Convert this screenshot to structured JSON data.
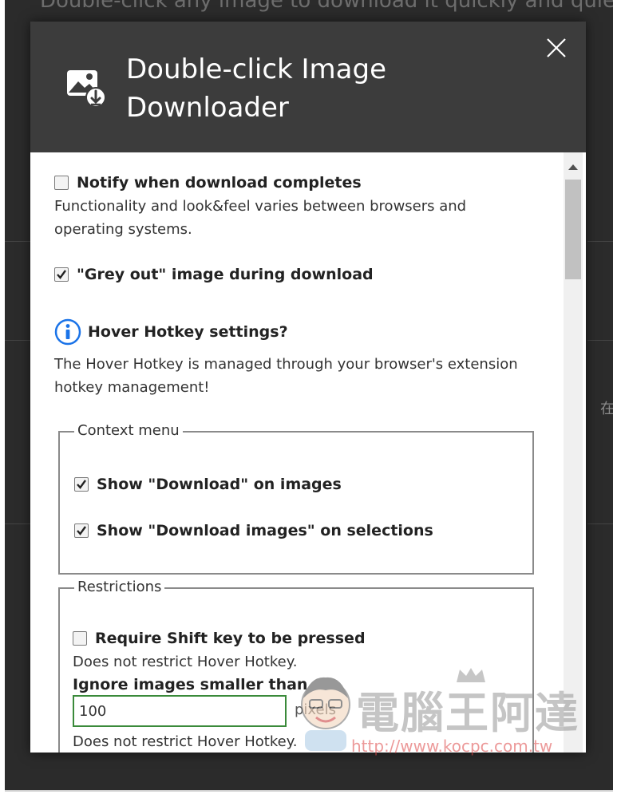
{
  "background": {
    "text": "Double-click any image to download it quickly and quietly, or",
    "side_char": "在"
  },
  "dialog": {
    "title": "Double-click Image Downloader",
    "close_label": "×"
  },
  "options": {
    "notify": {
      "label": "Notify when download completes",
      "checked": false,
      "description": "Functionality and look&feel varies between browsers and operating systems."
    },
    "grey_out": {
      "label": "\"Grey out\" image during download",
      "checked": true
    },
    "hotkey_info": {
      "title": "Hover Hotkey settings?",
      "description": "The Hover Hotkey is managed through your browser's extension hotkey management!"
    }
  },
  "context_menu": {
    "legend": "Context menu",
    "items": [
      {
        "label": "Show \"Download\" on images",
        "checked": true
      },
      {
        "label": "Show \"Download images\" on selections",
        "checked": true
      }
    ]
  },
  "restrictions": {
    "legend": "Restrictions",
    "shift": {
      "label": "Require Shift key to be pressed",
      "checked": false,
      "description": "Does not restrict Hover Hotkey."
    },
    "min_size": {
      "label": "Ignore images smaller than",
      "value": "100",
      "unit": "pixels",
      "description": "Does not restrict Hover Hotkey."
    }
  },
  "watermark": {
    "text": "電腦王阿達",
    "url": "http://www.kocpc.com.tw"
  },
  "colors": {
    "header_bg": "#3c3c3c",
    "info_icon": "#1a73e8",
    "input_border": "#3a8a3a"
  }
}
